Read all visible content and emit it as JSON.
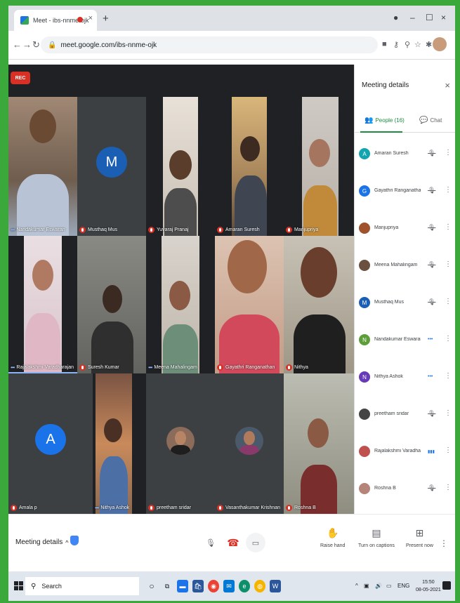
{
  "browser": {
    "tab_title": "Meet - ibs-nnme-ojk",
    "tab_close": "×",
    "new_tab": "+",
    "url": "meet.google.com/ibs-nnme-ojk",
    "win_min": "–",
    "win_max": "☐",
    "win_close": "×"
  },
  "meeting": {
    "rec_label": "REC",
    "tiles": [
      {
        "name": "Nandakumar Eswaran",
        "kind": "video",
        "ind": "dots"
      },
      {
        "name": "Musthaq Mus",
        "kind": "avatar",
        "letter": "M",
        "color": "#1a5fb4"
      },
      {
        "name": "Yuvaraj Pranaj",
        "kind": "video",
        "ind": "mic"
      },
      {
        "name": "Amaran Suresh",
        "kind": "video",
        "ind": "mic"
      },
      {
        "name": "Manjupriya",
        "kind": "video",
        "ind": "mic"
      },
      {
        "name": "Rajalakshmi Varadharajan",
        "kind": "video",
        "ind": "dots",
        "speaking": true
      },
      {
        "name": "Suresh Kumar",
        "kind": "video",
        "ind": "mic"
      },
      {
        "name": "Meena Mahalingam",
        "kind": "video",
        "ind": "dots"
      },
      {
        "name": "Gayathri Ranganathan",
        "kind": "video",
        "ind": "mic"
      },
      {
        "name": "Nithya",
        "kind": "video",
        "ind": "mic"
      },
      {
        "name": "Amala p",
        "kind": "avatar",
        "letter": "A",
        "color": "#1a73e8"
      },
      {
        "name": "Nithya Ashok",
        "kind": "video",
        "ind": "dots"
      },
      {
        "name": "preetham sridar",
        "kind": "photo",
        "ind": "mic"
      },
      {
        "name": "Vasanthakumar Krishnan",
        "kind": "photo",
        "ind": "mic"
      },
      {
        "name": "Roshna B",
        "kind": "video",
        "ind": "mic"
      }
    ]
  },
  "panel": {
    "title": "Meeting details",
    "close": "×",
    "tab_people": "People (16)",
    "tab_chat": "Chat",
    "people": [
      {
        "name": "Amaran Suresh",
        "letter": "A",
        "color": "#12a4af",
        "status": "muted"
      },
      {
        "name": "Gayathri Ranganathan",
        "letter": "G",
        "color": "#1a73e8",
        "status": "muted"
      },
      {
        "name": "Manjupriya",
        "letter": "",
        "color": "#a0522d",
        "status": "muted"
      },
      {
        "name": "Meena Mahalingam",
        "letter": "",
        "color": "#6b4f3f",
        "status": "muted"
      },
      {
        "name": "Musthaq Mus",
        "letter": "M",
        "color": "#1a5fb4",
        "status": "muted"
      },
      {
        "name": "Nandakumar Eswaran",
        "letter": "N",
        "color": "#5e9e3a",
        "status": "talking"
      },
      {
        "name": "Nithya Ashok",
        "letter": "N",
        "color": "#673ab7",
        "status": "talking"
      },
      {
        "name": "preetham sridar",
        "letter": "",
        "color": "#444",
        "status": "muted"
      },
      {
        "name": "Rajalakshmi Varadharajan",
        "letter": "",
        "color": "#c0504d",
        "status": "speaking"
      },
      {
        "name": "Roshna B",
        "letter": "",
        "color": "#b5857a",
        "status": "muted"
      }
    ]
  },
  "bottom": {
    "meeting_details": "Meeting details",
    "caret": "^",
    "raise_hand": "Raise hand",
    "captions": "Turn on captions",
    "present": "Present now"
  },
  "taskbar": {
    "search": "Search",
    "lang": "ENG",
    "time": "15:50",
    "date": "08-05-2021"
  }
}
